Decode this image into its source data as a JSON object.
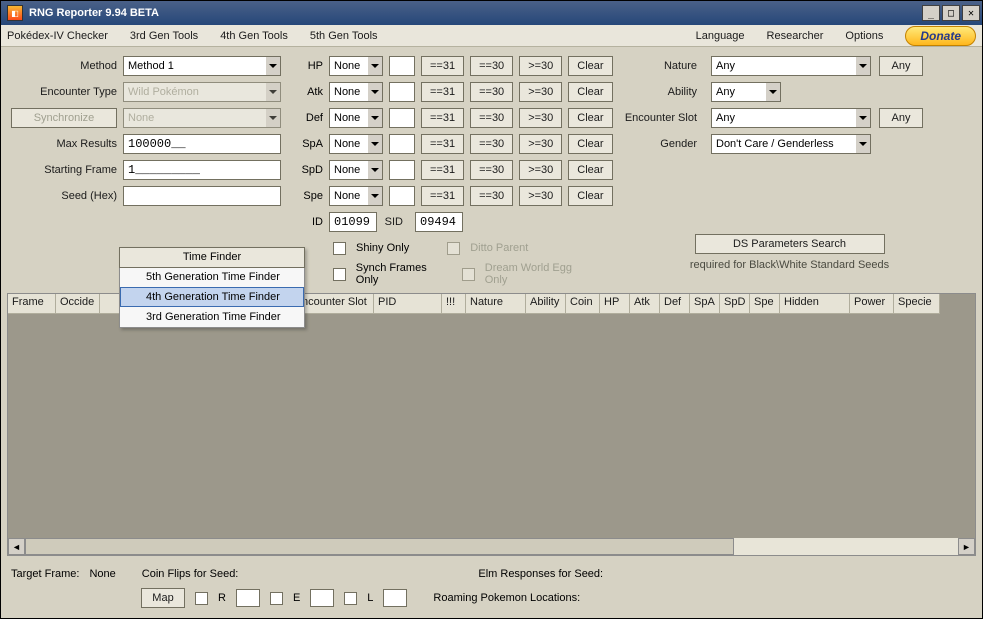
{
  "title": "RNG Reporter 9.94 BETA",
  "menu": {
    "pokedex": "Pokédex-IV Checker",
    "gen3": "3rd Gen Tools",
    "gen4": "4th Gen Tools",
    "gen5": "5th Gen Tools",
    "language": "Language",
    "researcher": "Researcher",
    "options": "Options",
    "donate": "Donate"
  },
  "left": {
    "method_lbl": "Method",
    "method_val": "Method 1",
    "enc_lbl": "Encounter Type",
    "enc_val": "Wild Pokémon",
    "sync_btn": "Synchronize",
    "sync_val": "None",
    "max_lbl": "Max Results",
    "max_val": "100000__",
    "frame_lbl": "Starting Frame",
    "frame_val": "1_________",
    "seed_lbl": "Seed (Hex)",
    "seed_val": ""
  },
  "stats": {
    "hp": "HP",
    "atk": "Atk",
    "def": "Def",
    "spa": "SpA",
    "spd": "SpD",
    "spe": "Spe",
    "none": "None",
    "eq31": "==31",
    "eq30": "==30",
    "ge30": ">=30",
    "clear": "Clear"
  },
  "ids": {
    "id_lbl": "ID",
    "id_val": "01099",
    "sid_lbl": "SID",
    "sid_val": "09494"
  },
  "checks": {
    "shiny": "Shiny Only",
    "ditto": "Ditto Parent",
    "synch": "Synch Frames Only",
    "dream": "Dream World Egg Only"
  },
  "right": {
    "nature_lbl": "Nature",
    "nature_val": "Any",
    "any_btn": "Any",
    "ability_lbl": "Ability",
    "ability_val": "Any",
    "slot_lbl": "Encounter Slot",
    "slot_val": "Any",
    "gender_lbl": "Gender",
    "gender_val": "Don't Care / Genderless",
    "ds_btn": "DS Parameters Search",
    "ds_note": "required for Black\\White Standard Seeds"
  },
  "dropdown": {
    "head": "Time Finder",
    "i1": "5th Generation Time Finder",
    "i2": "4th Generation Time Finder",
    "i3": "3rd Generation Time Finder"
  },
  "grid_cols": {
    "c0": "Frame",
    "c1": "Occide",
    "c2": "ncounter Slot",
    "c3": "PID",
    "c4": "!!!",
    "c5": "Nature",
    "c6": "Ability",
    "c7": "Coin",
    "c8": "HP",
    "c9": "Atk",
    "c10": "Def",
    "c11": "SpA",
    "c12": "SpD",
    "c13": "Spe",
    "c14": "Hidden",
    "c15": "Power",
    "c16": "Specie"
  },
  "footer": {
    "target": "Target Frame:",
    "target_val": "None",
    "coin": "Coin Flips for Seed:",
    "elm": "Elm Responses for Seed:",
    "map_btn": "Map",
    "r": "R",
    "e": "E",
    "l": "L",
    "roam": "Roaming Pokemon Locations:"
  }
}
